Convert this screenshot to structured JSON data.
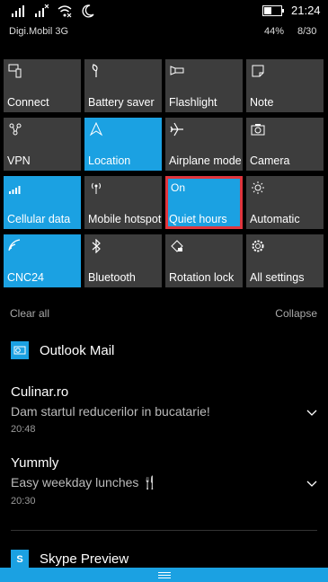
{
  "status": {
    "carrier": "Digi.Mobil 3G",
    "time": "21:24",
    "battery_pct": "44%",
    "page_count": "8/30",
    "battery_level": 0.44,
    "icons": [
      "signal-icon",
      "signal-x-icon",
      "wifi-x-icon",
      "moon-icon"
    ]
  },
  "quick_actions": {
    "connect": "Connect",
    "battery_saver": "Battery saver",
    "flashlight": "Flashlight",
    "note": "Note",
    "vpn": "VPN",
    "location": "Location",
    "airplane_mode": "Airplane mode",
    "camera": "Camera",
    "cellular_data": "Cellular data",
    "mobile_hotspot": "Mobile hotspot",
    "quiet_hours_state": "On",
    "quiet_hours": "Quiet hours",
    "automatic": "Automatic",
    "cnc24": "CNC24",
    "bluetooth": "Bluetooth",
    "rotation_lock": "Rotation lock",
    "all_settings": "All settings"
  },
  "action_center": {
    "clear_all": "Clear all",
    "collapse": "Collapse"
  },
  "notifications": {
    "outlook": {
      "app": "Outlook Mail",
      "items": [
        {
          "title": "Culinar.ro",
          "body": "Dam startul reducerilor in bucatarie!",
          "time": "20:48"
        },
        {
          "title": "Yummly",
          "body": "Easy weekday lunches 🍴",
          "time": "20:30"
        }
      ]
    },
    "skype": {
      "app": "Skype Preview"
    }
  },
  "colors": {
    "accent": "#1ba1e2",
    "tile_off": "#3d3d3d",
    "selection": "#e0353d",
    "background": "#000000"
  }
}
